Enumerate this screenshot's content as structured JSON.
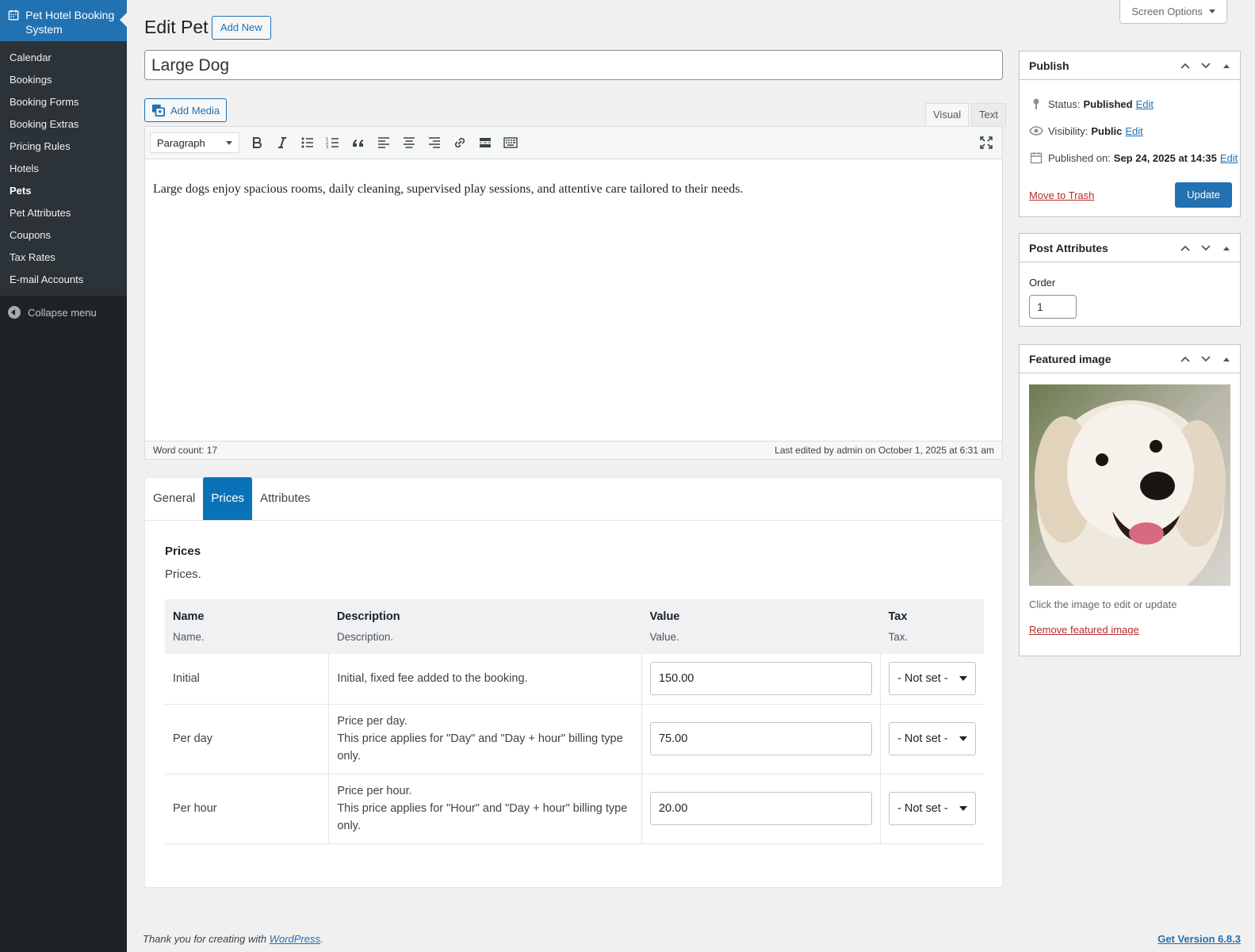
{
  "sidebar": {
    "brand": "Pet Hotel Booking System",
    "items": [
      {
        "label": "Calendar"
      },
      {
        "label": "Bookings"
      },
      {
        "label": "Booking Forms"
      },
      {
        "label": "Booking Extras"
      },
      {
        "label": "Pricing Rules"
      },
      {
        "label": "Hotels"
      },
      {
        "label": "Pets"
      },
      {
        "label": "Pet Attributes"
      },
      {
        "label": "Coupons"
      },
      {
        "label": "Tax Rates"
      },
      {
        "label": "E-mail Accounts"
      }
    ],
    "active": "Pets",
    "collapse_label": "Collapse menu"
  },
  "header": {
    "screen_options": "Screen Options",
    "title": "Edit Pet",
    "add_new": "Add New"
  },
  "post": {
    "title": "Large Dog"
  },
  "editor": {
    "add_media": "Add Media",
    "tab_visual": "Visual",
    "tab_text": "Text",
    "format": "Paragraph",
    "content": "Large dogs enjoy spacious rooms, daily cleaning, supervised play sessions, and attentive care tailored to their needs.",
    "word_count": "Word count: 17",
    "last_edited": "Last edited by admin on October 1, 2025 at 6:31 am"
  },
  "panel": {
    "tabs": [
      {
        "label": "General"
      },
      {
        "label": "Prices"
      },
      {
        "label": "Attributes"
      }
    ],
    "active_tab": "Prices",
    "section_title": "Prices",
    "section_desc": "Prices.",
    "columns": [
      {
        "title": "Name",
        "sub": "Name."
      },
      {
        "title": "Description",
        "sub": "Description."
      },
      {
        "title": "Value",
        "sub": "Value."
      },
      {
        "title": "Tax",
        "sub": "Tax."
      }
    ],
    "rows": [
      {
        "name": "Initial",
        "desc1": "Initial, fixed fee added to the booking.",
        "desc2": "",
        "value": "150.00",
        "tax": "- Not set -"
      },
      {
        "name": "Per day",
        "desc1": "Price per day.",
        "desc2": "This price applies for \"Day\" and \"Day + hour\" billing type only.",
        "value": "75.00",
        "tax": "- Not set -"
      },
      {
        "name": "Per hour",
        "desc1": "Price per hour.",
        "desc2": "This price applies for \"Hour\" and \"Day + hour\" billing type only.",
        "value": "20.00",
        "tax": "- Not set -"
      }
    ]
  },
  "publish": {
    "title": "Publish",
    "status_label": "Status:",
    "status_value": "Published",
    "visibility_label": "Visibility:",
    "visibility_value": "Public",
    "published_label": "Published on:",
    "published_value": "Sep 24, 2025 at 14:35",
    "edit": "Edit",
    "trash": "Move to Trash",
    "update": "Update"
  },
  "post_attributes": {
    "title": "Post Attributes",
    "order_label": "Order",
    "order_value": "1"
  },
  "featured": {
    "title": "Featured image",
    "hint": "Click the image to edit or update",
    "remove": "Remove featured image"
  },
  "footer": {
    "thanks_prefix": "Thank you for creating with",
    "wp_link": "WordPress",
    "thanks_suffix": ".",
    "version": "Get Version 6.8.3"
  },
  "colors": {
    "admin_bar": "#1d2327",
    "menu_bg": "#2c3338",
    "accent": "#2271b1",
    "tab_active": "#0a73b8",
    "danger": "#b32d2e"
  }
}
